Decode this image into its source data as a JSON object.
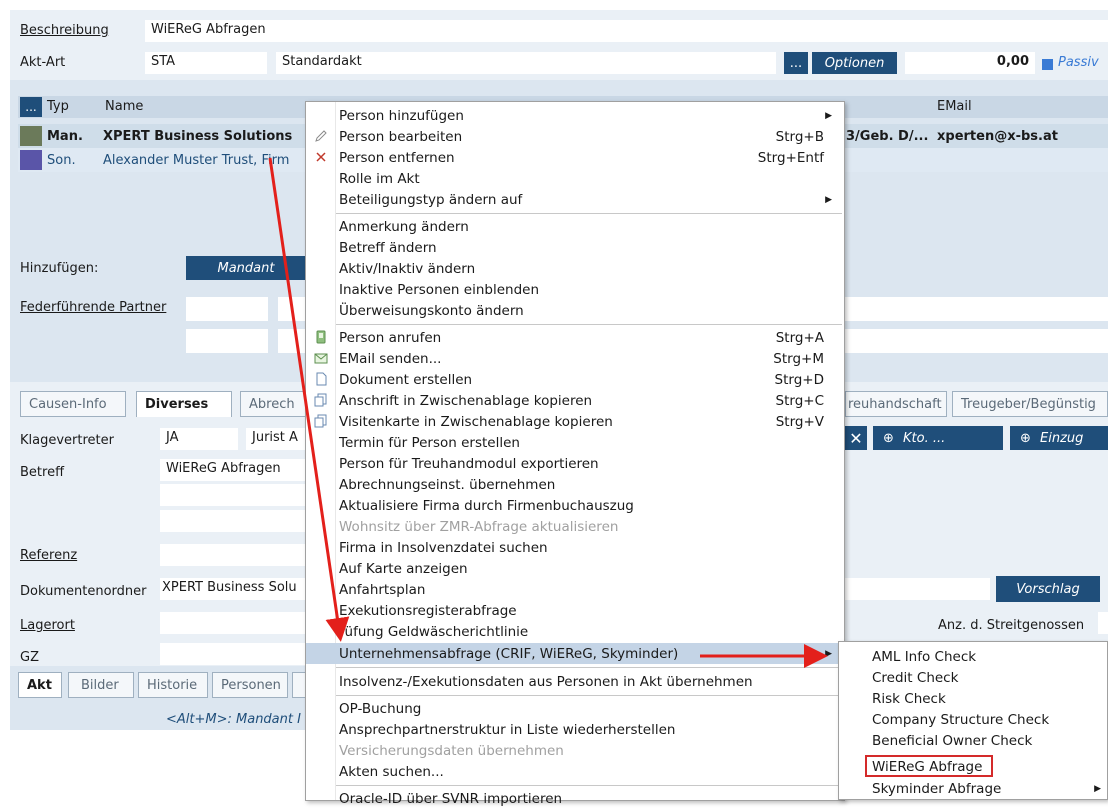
{
  "header": {
    "beschreibung_label": "Beschreibung",
    "beschreibung_value": "WiEReG Abfragen",
    "aktart_label": "Akt-Art",
    "aktart_code": "STA",
    "aktart_name": "Standardakt",
    "dots_label": "...",
    "optionen_label": "Optionen",
    "amount": "0,00",
    "passiv_label": "Passiv"
  },
  "grid": {
    "dots_label": "...",
    "col_typ": "Typ",
    "col_name": "Name",
    "col_email": "EMail",
    "rows": [
      {
        "typ": "Man.",
        "name": "XPERT Business Solutions",
        "extra": "3/Geb. D/...",
        "email": "xperten@x-bs.at",
        "color": "#6b7a5a"
      },
      {
        "typ": "Son.",
        "name": "Alexander Muster Trust, Firm",
        "extra": "",
        "email": "",
        "color": "#5a55a8"
      }
    ]
  },
  "hinzufuegen": {
    "label": "Hinzufügen:",
    "mandant_button": "Mandant"
  },
  "federfuehrende_label": "Federführende Partner",
  "tabs": [
    "Causen-Info",
    "Diverses",
    "Abrech",
    "reuhandschaft",
    "Treugeber/Begünstig"
  ],
  "diverses": {
    "klagevertreter_label": "Klagevertreter",
    "klagevertreter_value": "JA",
    "jurist_value": "Jurist A",
    "kto_button": "Kto. ...",
    "einzug_button": "Einzug",
    "betreff_label": "Betreff",
    "betreff_value": "WiEReG Abfragen",
    "referenz_label": "Referenz",
    "dokumentenordner_label": "Dokumentenordner",
    "dokumentenordner_value": "XPERT Business Solu",
    "vorschlag_button": "Vorschlag",
    "lagerort_label": "Lagerort",
    "streitgenossen_label": "Anz. d. Streitgenossen",
    "gz_label": "GZ"
  },
  "bottom_tabs": [
    "Akt",
    "Bilder",
    "Historie",
    "Personen"
  ],
  "hint": "<Alt+M>: Mandant I",
  "context_menu": {
    "items": [
      {
        "label": "Person hinzufügen",
        "shortcut": "",
        "submenu": true
      },
      {
        "label": "Person bearbeiten",
        "shortcut": "Strg+B",
        "icon": "pencil-icon"
      },
      {
        "label": "Person entfernen",
        "shortcut": "Strg+Entf",
        "icon": "x-icon"
      },
      {
        "label": "Rolle im Akt",
        "shortcut": ""
      },
      {
        "label": "Beteiligungstyp ändern auf",
        "shortcut": "",
        "submenu": true
      },
      {
        "label": "Anmerkung ändern",
        "shortcut": ""
      },
      {
        "label": "Betreff ändern",
        "shortcut": ""
      },
      {
        "label": "Aktiv/Inaktiv ändern",
        "shortcut": ""
      },
      {
        "label": "Inaktive Personen einblenden",
        "shortcut": ""
      },
      {
        "label": "Überweisungskonto ändern",
        "shortcut": ""
      },
      {
        "label": "Person anrufen",
        "shortcut": "Strg+A",
        "icon": "phone-icon"
      },
      {
        "label": "EMail senden...",
        "shortcut": "Strg+M",
        "icon": "envelope-icon"
      },
      {
        "label": "Dokument erstellen",
        "shortcut": "Strg+D",
        "icon": "document-icon"
      },
      {
        "label": "Anschrift in Zwischenablage kopieren",
        "shortcut": "Strg+C",
        "icon": "copy-icon"
      },
      {
        "label": "Visitenkarte in Zwischenablage kopieren",
        "shortcut": "Strg+V",
        "icon": "copy-icon"
      },
      {
        "label": "Termin für Person erstellen",
        "shortcut": ""
      },
      {
        "label": "Person für Treuhandmodul exportieren",
        "shortcut": ""
      },
      {
        "label": "Abrechnungseinst. übernehmen",
        "shortcut": ""
      },
      {
        "label": "Aktualisiere Firma durch Firmenbuchauszug",
        "shortcut": ""
      },
      {
        "label": "Wohnsitz über ZMR-Abfrage aktualisieren",
        "shortcut": "",
        "disabled": true
      },
      {
        "label": "Firma in Insolvenzdatei suchen",
        "shortcut": ""
      },
      {
        "label": "Auf Karte anzeigen",
        "shortcut": ""
      },
      {
        "label": "Anfahrtsplan",
        "shortcut": ""
      },
      {
        "label": "Exekutionsregisterabfrage",
        "shortcut": ""
      },
      {
        "label": "rüfung Geldwäscherichtlinie",
        "shortcut": ""
      },
      {
        "label": "Unternehmensabfrage (CRIF, WiEReG, Skyminder)",
        "shortcut": "",
        "submenu": true,
        "highlighted": true
      },
      {
        "label": "Insolvenz-/Exekutionsdaten aus Personen in Akt übernehmen",
        "shortcut": ""
      },
      {
        "label": "OP-Buchung",
        "shortcut": ""
      },
      {
        "label": "Ansprechpartnerstruktur in Liste wiederherstellen",
        "shortcut": ""
      },
      {
        "label": "Versicherungsdaten übernehmen",
        "shortcut": "",
        "disabled": true
      },
      {
        "label": "Akten suchen...",
        "shortcut": ""
      },
      {
        "label": "Oracle-ID über SVNR importieren",
        "shortcut": ""
      }
    ]
  },
  "submenu": {
    "items": [
      {
        "label": "AML Info Check"
      },
      {
        "label": "Credit Check"
      },
      {
        "label": "Risk Check"
      },
      {
        "label": "Company Structure Check"
      },
      {
        "label": "Beneficial Owner Check"
      },
      {
        "label": "WiEReG Abfrage",
        "boxed": true
      },
      {
        "label": "Skyminder Abfrage",
        "submenu": true
      }
    ]
  },
  "colors": {
    "accent_dark": "#1f4e7a",
    "highlight": "#c4d4e6",
    "annotation_red": "#e3201b",
    "passiv_square": "#3a7bd5"
  }
}
